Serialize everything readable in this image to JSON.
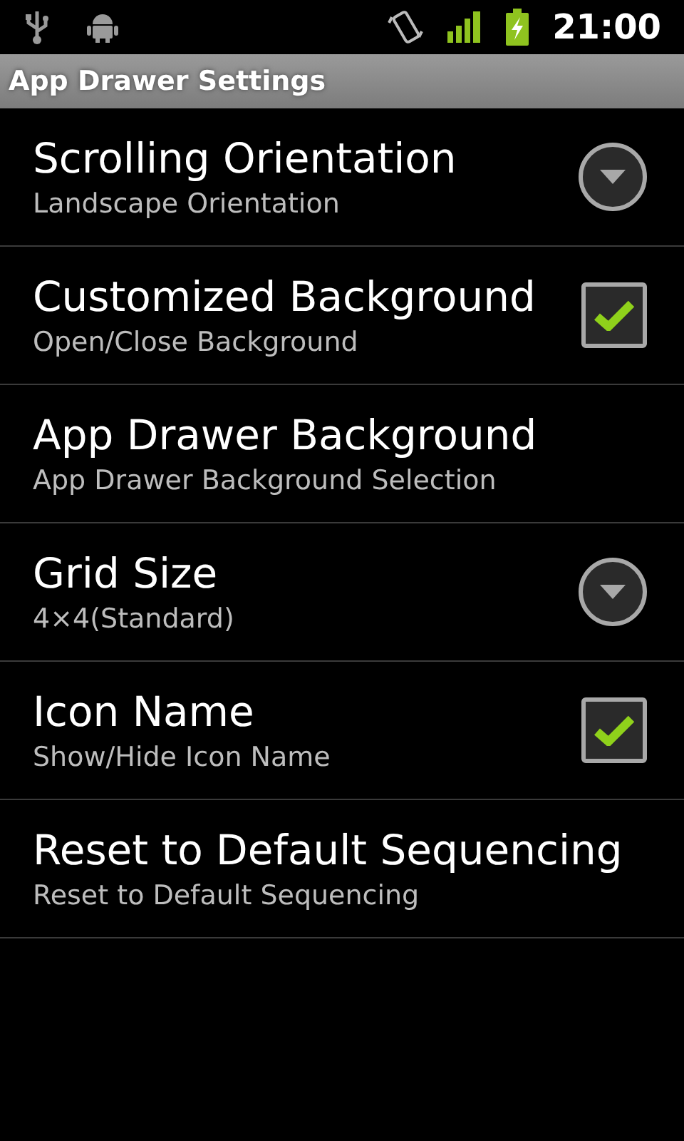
{
  "status_bar": {
    "time": "21:00"
  },
  "title_bar": {
    "title": "App Drawer Settings"
  },
  "settings": [
    {
      "title": "Scrolling Orientation",
      "summary": "Landscape Orientation",
      "kind": "dropdown"
    },
    {
      "title": "Customized Background",
      "summary": "Open/Close Background",
      "kind": "checkbox",
      "checked": true
    },
    {
      "title": "App Drawer Background",
      "summary": "App Drawer Background Selection",
      "kind": "plain"
    },
    {
      "title": "Grid Size",
      "summary": "4×4(Standard)",
      "kind": "dropdown"
    },
    {
      "title": "Icon Name",
      "summary": "Show/Hide Icon Name",
      "kind": "checkbox",
      "checked": true
    },
    {
      "title": "Reset to Default Sequencing",
      "summary": "Reset to Default Sequencing",
      "kind": "plain"
    }
  ]
}
